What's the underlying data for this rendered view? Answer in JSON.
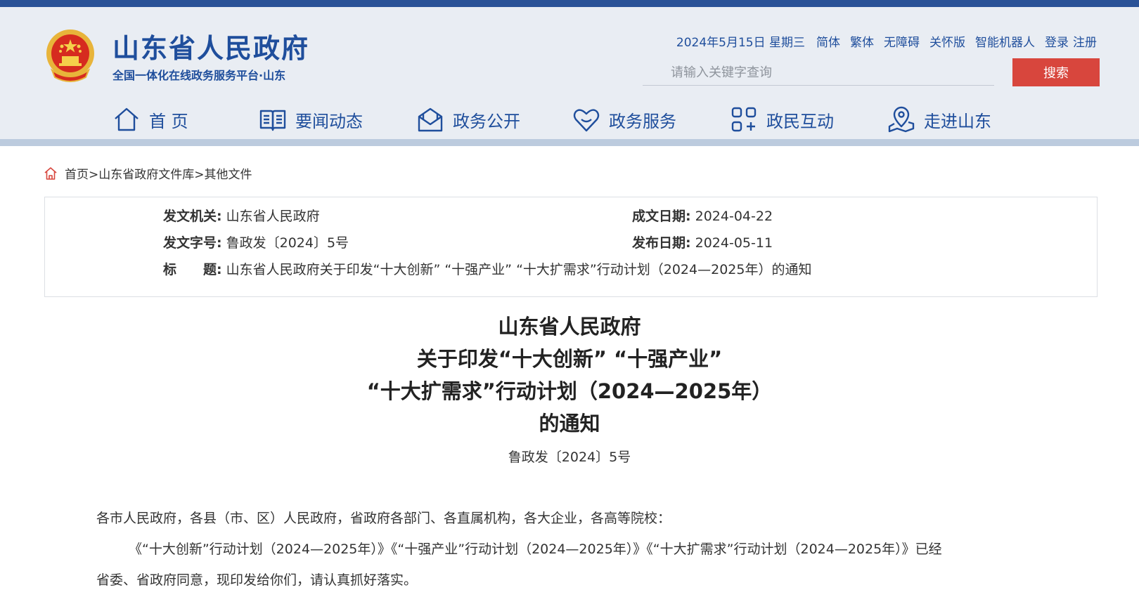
{
  "header": {
    "site_title": "山东省人民政府",
    "site_subtitle": "全国一体化在线政务服务平台·山东",
    "date": "2024年5月15日 星期三",
    "links": [
      "简体",
      "繁体",
      "无障碍",
      "关怀版",
      "智能机器人"
    ],
    "login": "登录",
    "register": "注册",
    "search_placeholder": "请输入关键字查询",
    "search_button": "搜索"
  },
  "nav": {
    "items": [
      {
        "label": "首 页",
        "icon": "home-icon"
      },
      {
        "label": "要闻动态",
        "icon": "book-icon"
      },
      {
        "label": "政务公开",
        "icon": "mail-icon"
      },
      {
        "label": "政务服务",
        "icon": "heart-icon"
      },
      {
        "label": "政民互动",
        "icon": "interaction-icon"
      },
      {
        "label": "走进山东",
        "icon": "location-icon"
      }
    ]
  },
  "breadcrumb": {
    "home": "首页",
    "library": "山东省政府文件库",
    "current": "其他文件",
    "separator": ">"
  },
  "meta": {
    "issuer_label": "发文机关:",
    "issuer": "山东省人民政府",
    "doc_no_label": "发文字号:",
    "doc_no": "鲁政发〔2024〕5号",
    "title_label": "标　　题:",
    "title": "山东省人民政府关于印发“十大创新” “十强产业” “十大扩需求”行动计划（2024—2025年）的通知",
    "written_label": "成文日期:",
    "written_date": "2024-04-22",
    "published_label": "发布日期:",
    "published_date": "2024-05-11"
  },
  "document": {
    "title_lines": [
      "山东省人民政府",
      "关于印发“十大创新”  “十强产业”",
      "“十大扩需求”行动计划（2024—2025年）",
      "的通知"
    ],
    "number": "鲁政发〔2024〕5号",
    "salutation": "各市人民政府，各县（市、区）人民政府，省政府各部门、各直属机构，各大企业，各高等院校：",
    "paragraph_line1": "《“十大创新”行动计划（2024—2025年）》《“十强产业”行动计划（2024—2025年）》《“十大扩需求”行动计划（2024—2025年）》已经",
    "paragraph_line2": "省委、省政府同意，现印发给你们，请认真抓好落实。"
  },
  "colors": {
    "brand_blue": "#1f4e9c",
    "search_red": "#d8463d",
    "header_bg": "#e9edf3",
    "top_strip": "#2a5297"
  }
}
